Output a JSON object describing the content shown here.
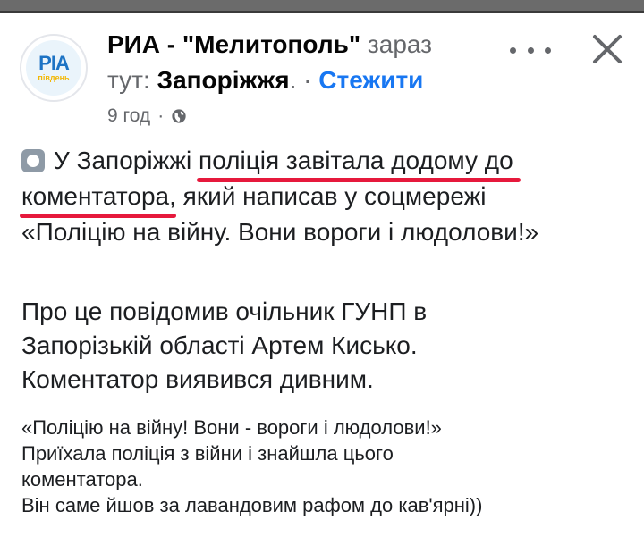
{
  "post": {
    "page_name": "РИА - \"Мелитополь\"",
    "status_before": "зараз",
    "status_prefix": "тут:",
    "location": "Запоріжжя",
    "location_suffix": ". ·",
    "follow_label": "Стежити",
    "time": "9 год",
    "time_separator": "·",
    "avatar_logo_main": "РІА",
    "avatar_logo_sub": "південь",
    "text": {
      "l1_pre": "У Запоріжжі ",
      "l1_hl": "поліція завітала додому до",
      "l2_hl": "коментатора",
      "l2_post": ", який написав у соцмережі",
      "l3": "«Поліцію на війну. Вони вороги і людолови!»"
    },
    "para2": [
      "Про це повідомив очільник ГУНП в",
      "Запорізькій області Артем Кисько.",
      "Коментатор виявився дивним."
    ],
    "quote": [
      "«Поліцію на війну! Вони - вороги і людолови!»",
      "Приїхала поліція з війни і знайшла цього",
      "коментатора.",
      "Він саме йшов за лавандовим рафом до кав'ярні))"
    ]
  },
  "colors": {
    "accent": "#1877f2",
    "highlight": "#e6193c",
    "muted": "#65676b"
  },
  "icons": {
    "globe": "globe-icon",
    "more": "more-dots-icon",
    "close": "close-icon",
    "emoji": "white-circle-emoji"
  }
}
